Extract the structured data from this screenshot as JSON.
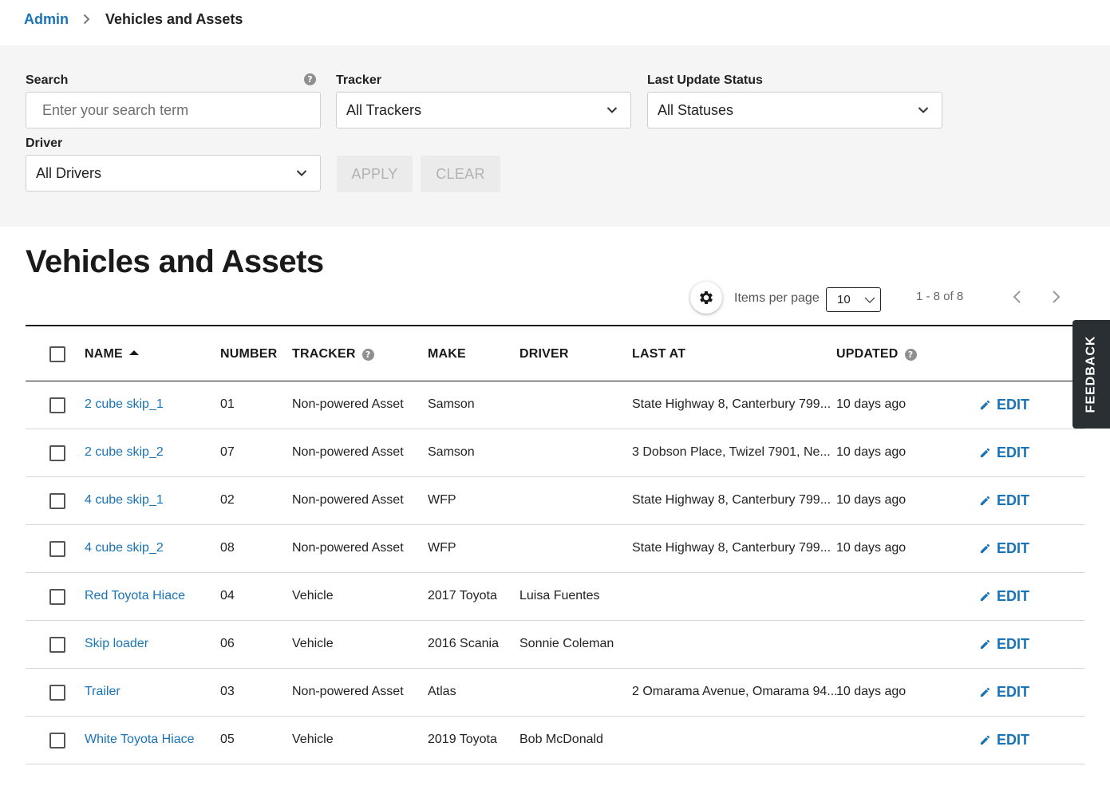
{
  "breadcrumb": {
    "parent": "Admin",
    "current": "Vehicles and Assets"
  },
  "filters": {
    "search": {
      "label": "Search",
      "placeholder": "Enter your search term",
      "help": "?"
    },
    "tracker": {
      "label": "Tracker",
      "value": "All Trackers"
    },
    "status": {
      "label": "Last Update Status",
      "value": "All Statuses"
    },
    "driver": {
      "label": "Driver",
      "value": "All Drivers"
    },
    "apply": "APPLY",
    "clear": "CLEAR"
  },
  "page_title": "Vehicles and Assets",
  "toolbar": {
    "items_per_page_label": "Items per page",
    "items_per_page": "10",
    "range": "1 - 8 of 8"
  },
  "table": {
    "columns": {
      "name": "NAME",
      "number": "NUMBER",
      "tracker": "TRACKER",
      "make": "MAKE",
      "driver": "DRIVER",
      "last_at": "LAST AT",
      "updated": "UPDATED"
    },
    "help": "?",
    "edit_label": "EDIT",
    "rows": [
      {
        "name": "2 cube skip_1",
        "number": "01",
        "tracker": "Non-powered Asset",
        "make": "Samson",
        "driver": "",
        "last_at": "State Highway 8, Canterbury 799...",
        "updated": "10 days ago"
      },
      {
        "name": "2 cube skip_2",
        "number": "07",
        "tracker": "Non-powered Asset",
        "make": "Samson",
        "driver": "",
        "last_at": "3 Dobson Place, Twizel 7901, Ne...",
        "updated": "10 days ago"
      },
      {
        "name": "4 cube skip_1",
        "number": "02",
        "tracker": "Non-powered Asset",
        "make": "WFP",
        "driver": "",
        "last_at": "State Highway 8, Canterbury 799...",
        "updated": "10 days ago"
      },
      {
        "name": "4 cube skip_2",
        "number": "08",
        "tracker": "Non-powered Asset",
        "make": "WFP",
        "driver": "",
        "last_at": "State Highway 8, Canterbury 799...",
        "updated": "10 days ago"
      },
      {
        "name": "Red Toyota Hiace",
        "number": "04",
        "tracker": "Vehicle",
        "make": "2017 Toyota",
        "driver": "Luisa Fuentes",
        "last_at": "",
        "updated": ""
      },
      {
        "name": "Skip loader",
        "number": "06",
        "tracker": "Vehicle",
        "make": "2016 Scania",
        "driver": "Sonnie Coleman",
        "last_at": "",
        "updated": ""
      },
      {
        "name": "Trailer",
        "number": "03",
        "tracker": "Non-powered Asset",
        "make": "Atlas",
        "driver": "",
        "last_at": "2 Omarama Avenue, Omarama 94...",
        "updated": "10 days ago"
      },
      {
        "name": "White Toyota Hiace",
        "number": "05",
        "tracker": "Vehicle",
        "make": "2019 Toyota",
        "driver": "Bob McDonald",
        "last_at": "",
        "updated": ""
      }
    ]
  },
  "feedback": "FEEDBACK",
  "colors": {
    "link": "#1a73b5",
    "panel": "#f5f5f5",
    "feedback_bg": "#2a2f33"
  },
  "icons": [
    "chevron-right-icon",
    "help-icon",
    "chevron-down-icon",
    "gear-icon",
    "chevron-left-icon",
    "sort-ascending-icon",
    "pencil-icon"
  ]
}
